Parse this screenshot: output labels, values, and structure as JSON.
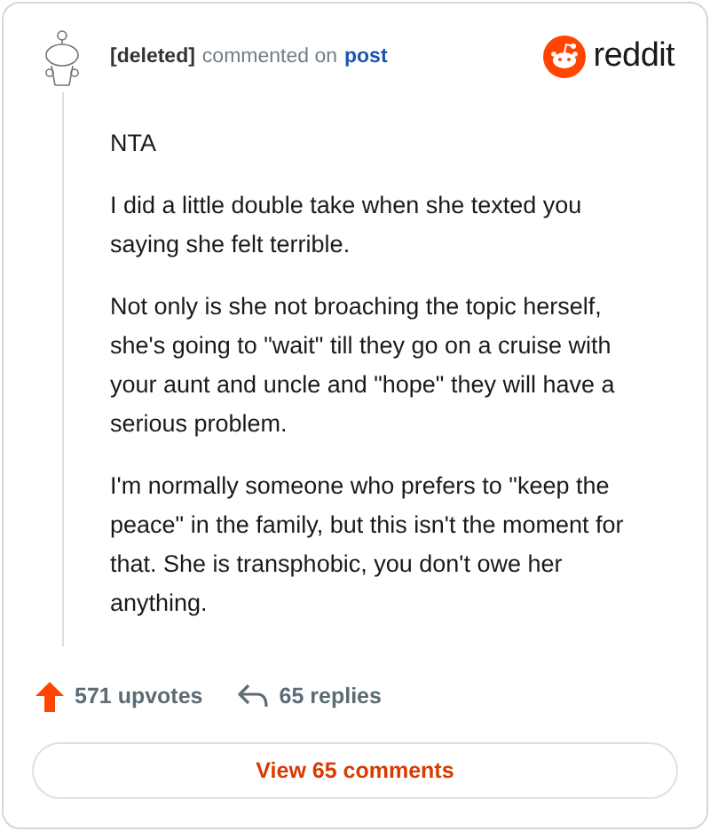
{
  "header": {
    "author": "[deleted]",
    "action": "commented on",
    "target": "post",
    "brand": "reddit"
  },
  "paragraphs": [
    "NTA",
    "I did a little double take when she texted you saying she felt terrible.",
    "Not only is she not broaching the topic herself, she's going to \"wait\" till they go on a cruise with your aunt and uncle and \"hope\" they will have a serious problem.",
    "I'm normally someone who prefers to \"keep the peace\" in the family, but this isn't the moment for that. She is transphobic, you don't owe her anything."
  ],
  "stats": {
    "upvotes": "571 upvotes",
    "replies": "65 replies"
  },
  "button": "View 65 comments"
}
